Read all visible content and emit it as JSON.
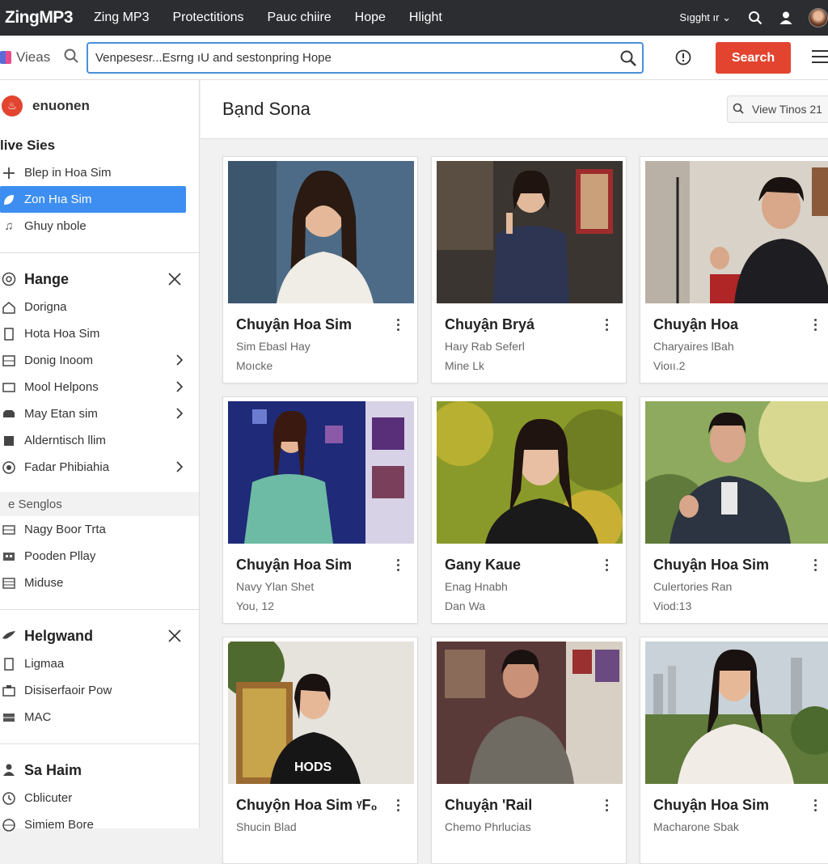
{
  "topbar": {
    "logo": "ZingMP3",
    "nav": [
      "Zing MP3",
      "Protectitions",
      "Pauc chiire",
      "Hope",
      "Hlight"
    ],
    "signin": "Sıgght ır",
    "icons": [
      "search-icon",
      "user-icon",
      "avatar"
    ]
  },
  "toolbar": {
    "views_label": "Vieas",
    "search_value": "Venpesesr...Esrng ıU and sestonpring Hope",
    "search_button": "Search",
    "accent": "#e2442f",
    "focus_color": "#4a90d9"
  },
  "sidebar": {
    "user_name": "enuonen",
    "section1_title": "live Sies",
    "section1_items": [
      {
        "label": "Blep in Hoa Sim",
        "icon": "plus-icon"
      },
      {
        "label": "Zon Hıa Sim",
        "icon": "leaf-icon",
        "active": true
      },
      {
        "label": "Ghuy nbole",
        "icon": "music-note-icon"
      }
    ],
    "group1_title": "Hange",
    "group1_items": [
      {
        "label": "Dorigna",
        "icon": "home-icon"
      },
      {
        "label": "Hota Hoa Sim",
        "icon": "bookmark-icon"
      },
      {
        "label": "Donig Inoom",
        "icon": "grid-icon",
        "chevron": true
      },
      {
        "label": "Mool Helpons",
        "icon": "monitor-icon",
        "chevron": true
      },
      {
        "label": "May Etan sim",
        "icon": "car-icon",
        "chevron": true
      },
      {
        "label": "Alderntisch llim",
        "icon": "badge-icon"
      },
      {
        "label": "Fadar Phibiahia",
        "icon": "disc-icon",
        "chevron": true
      }
    ],
    "subhead": "e Senglos",
    "subhead_items": [
      {
        "label": "Nagy Boor Trta",
        "icon": "list-icon"
      },
      {
        "label": "Pooden Pllay",
        "icon": "grid-icon"
      },
      {
        "label": "Miduse",
        "icon": "list-icon"
      }
    ],
    "group2_title": "Helgwand",
    "group2_items": [
      {
        "label": "Ligmaa",
        "icon": "card-icon"
      },
      {
        "label": "Disiserfaoir Pow",
        "icon": "scan-icon"
      },
      {
        "label": "MAC",
        "icon": "bars-icon"
      }
    ],
    "group3_title": "Sa Haim",
    "group3_items": [
      {
        "label": "Cblicuter",
        "icon": "clock-icon"
      },
      {
        "label": "Simiem Bore",
        "icon": "globe-icon"
      }
    ],
    "active_color": "#3d8ef0"
  },
  "main": {
    "title": "Bạnd Sona",
    "view_button": "View Tinos 21",
    "cards": [
      {
        "title": "Chuyận Hoa Sim",
        "sub1": "Sim Ebasl Hay",
        "sub2": "Moıcke"
      },
      {
        "title": "Chuyận Bryá",
        "sub1": "Haıy Rab Seferl",
        "sub2": "Mine Lk"
      },
      {
        "title": "Chuyận Hoa",
        "sub1": "Charyaires lBah",
        "sub2": "Vioıı.2"
      },
      {
        "title": "Chuyận Hoa Sim",
        "sub1": "Navy Ylan Shet",
        "sub2": "You, 12"
      },
      {
        "title": "Gany Kaue",
        "sub1": "Enag Hnabh",
        "sub2": "Dan Wa"
      },
      {
        "title": "Chuyận Hoa Sim",
        "sub1": "Culertories Ran",
        "sub2": "Viod:13"
      },
      {
        "title": "Chuyộn Hoa Sim ᵞF₀",
        "sub1": "Shucin Blad",
        "sub2": ""
      },
      {
        "title": "Chuyận 'Rail",
        "sub1": "Chemo Phrlucias",
        "sub2": ""
      },
      {
        "title": "Chuyận Hoa Sim",
        "sub1": "Macharone Sbak",
        "sub2": ""
      }
    ]
  }
}
